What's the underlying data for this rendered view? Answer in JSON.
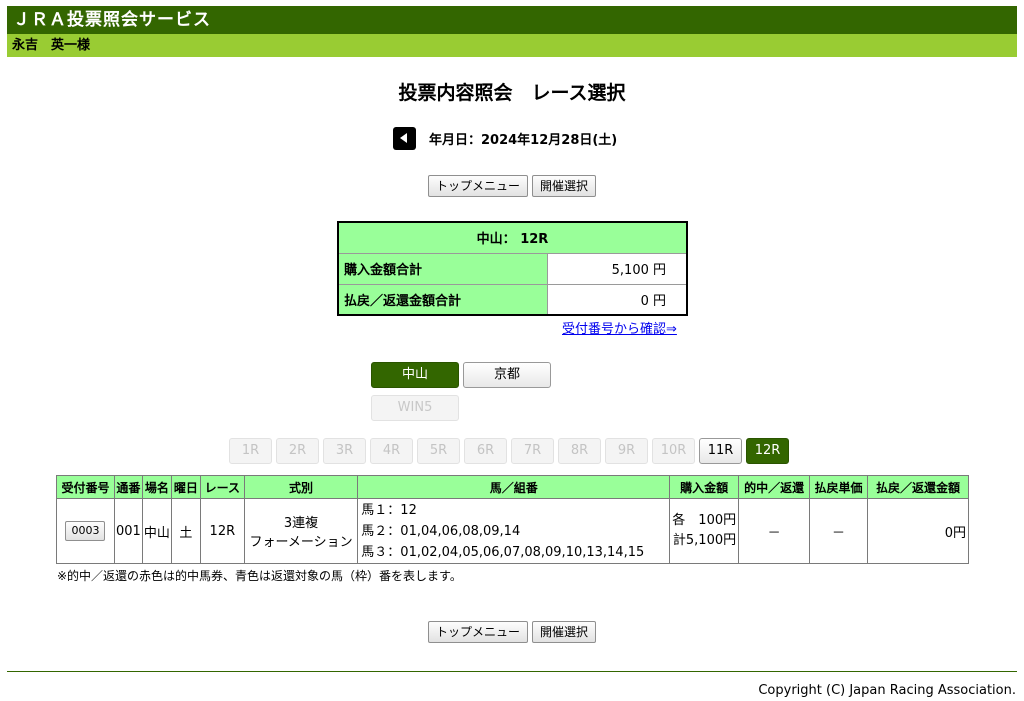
{
  "header": {
    "service_name": "ＪＲＡ投票照会サービス",
    "user_name": "永吉　英一様"
  },
  "page": {
    "title": "投票内容照会　レース選択",
    "date_label": "年月日：2024年12月28日(土)"
  },
  "nav": {
    "top_menu": "トップメニュー",
    "venue_select": "開催選択"
  },
  "summary": {
    "header": "中山： 12R",
    "purchase_label": "購入金額合計",
    "purchase_value": "5,100 円",
    "refund_label": "払戻／返還金額合計",
    "refund_value": "0 円"
  },
  "confirm_link": "受付番号から確認⇒",
  "venues": [
    {
      "label": "中山",
      "state": "active"
    },
    {
      "label": "京都",
      "state": "normal"
    }
  ],
  "win5": {
    "label": "WIN5",
    "state": "disabled"
  },
  "races": [
    {
      "label": "1R",
      "state": "disabled"
    },
    {
      "label": "2R",
      "state": "disabled"
    },
    {
      "label": "3R",
      "state": "disabled"
    },
    {
      "label": "4R",
      "state": "disabled"
    },
    {
      "label": "5R",
      "state": "disabled"
    },
    {
      "label": "6R",
      "state": "disabled"
    },
    {
      "label": "7R",
      "state": "disabled"
    },
    {
      "label": "8R",
      "state": "disabled"
    },
    {
      "label": "9R",
      "state": "disabled"
    },
    {
      "label": "10R",
      "state": "disabled"
    },
    {
      "label": "11R",
      "state": "normal"
    },
    {
      "label": "12R",
      "state": "active"
    }
  ],
  "table": {
    "headers": [
      "受付番号",
      "通番",
      "場名",
      "曜日",
      "レース",
      "式別",
      "馬／組番",
      "購入金額",
      "的中／返還",
      "払戻単価",
      "払戻／返還金額"
    ],
    "rows": [
      {
        "receipt": "0003",
        "serial": "001",
        "venue": "中山",
        "weekday": "土",
        "race": "12R",
        "bet_type_1": "3連複",
        "bet_type_2": "フォーメーション",
        "combo_1": "馬１：12",
        "combo_2": "馬２：01,04,06,08,09,14",
        "combo_3": "馬３：01,02,04,05,06,07,08,09,10,13,14,15",
        "amount_each": "各　100円",
        "amount_total": "計5,100円",
        "hit": "－",
        "unit_payout": "－",
        "payout": "0円"
      }
    ]
  },
  "note": "※的中／返還の赤色は的中馬券、青色は返還対象の馬（枠）番を表します。",
  "footer": {
    "copyright": "Copyright (C) Japan Racing Association."
  },
  "colors": {
    "header_dark_green": "#336600",
    "user_bar_green": "#99cc33",
    "table_head_green": "#99ff99",
    "link_blue": "#0000ee"
  }
}
